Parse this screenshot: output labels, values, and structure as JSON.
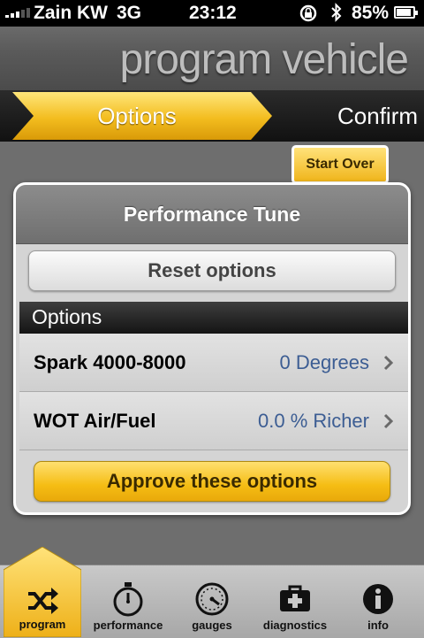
{
  "status_bar": {
    "carrier": "Zain KW",
    "network": "3G",
    "time": "23:12",
    "battery": "85%"
  },
  "header": {
    "title": "program vehicle"
  },
  "steps": {
    "active": "Options",
    "next": "Confirm"
  },
  "start_over_label": "Start Over",
  "modal": {
    "title": "Performance Tune",
    "reset_label": "Reset options",
    "section_label": "Options",
    "rows": [
      {
        "label": "Spark 4000-8000",
        "value": "0 Degrees"
      },
      {
        "label": "WOT Air/Fuel",
        "value": "0.0 % Richer"
      }
    ],
    "approve_label": "Approve these options"
  },
  "tabs": [
    {
      "label": "program",
      "icon": "shuffle-icon",
      "active": true
    },
    {
      "label": "performance",
      "icon": "stopwatch-icon",
      "active": false
    },
    {
      "label": "gauges",
      "icon": "gauge-icon",
      "active": false
    },
    {
      "label": "diagnostics",
      "icon": "medical-kit-icon",
      "active": false
    },
    {
      "label": "info",
      "icon": "info-icon",
      "active": false
    }
  ],
  "colors": {
    "accent_yellow": "#f5bd14",
    "value_blue": "#3c5d93",
    "dark_bar": "#141414"
  }
}
